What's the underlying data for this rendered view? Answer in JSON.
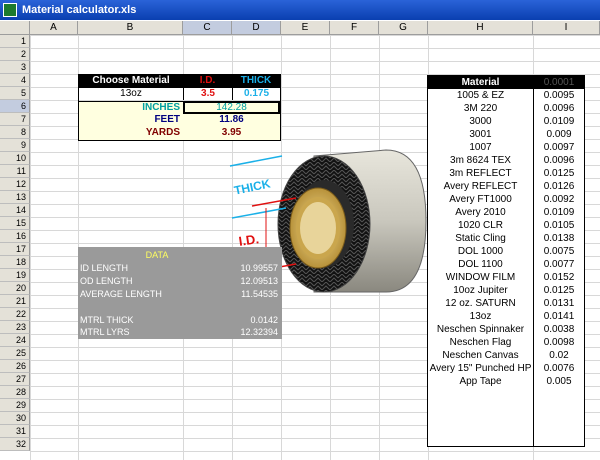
{
  "window": {
    "title": "Material calculator.xls"
  },
  "columns": [
    "A",
    "B",
    "C",
    "D",
    "E",
    "F",
    "G",
    "H",
    "I"
  ],
  "rows": [
    "1",
    "2",
    "3",
    "4",
    "5",
    "6",
    "7",
    "8",
    "9",
    "10",
    "11",
    "12",
    "13",
    "14",
    "15",
    "16",
    "17",
    "18",
    "19",
    "20",
    "21",
    "22",
    "23",
    "24",
    "25",
    "26",
    "27",
    "28",
    "29",
    "30",
    "31",
    "32"
  ],
  "calculator": {
    "choose_material_label": "Choose Material",
    "id_label": "I.D.",
    "thick_label": "THICK",
    "material_value": "13oz",
    "id_value": "3.5",
    "thick_value": "0.175",
    "inches_label": "INCHES",
    "inches_value": "142.28",
    "feet_label": "FEET",
    "feet_value": "11.86",
    "yards_label": "YARDS",
    "yards_value": "3.95"
  },
  "data_panel": {
    "title": "DATA",
    "id_length_label": "ID LENGTH",
    "id_length_value": "10.99557",
    "od_length_label": "OD LENGTH",
    "od_length_value": "12.09513",
    "avg_length_label": "AVERAGE LENGTH",
    "avg_length_value": "11.54535",
    "mtrl_thick_label": "MTRL THICK",
    "mtrl_thick_value": "0.0142",
    "mtrl_lyrs_label": "MTRL LYRS",
    "mtrl_lyrs_value": "12.32394"
  },
  "diagram": {
    "thick_label": "THICK",
    "id_label": "I.D."
  },
  "materials": {
    "header_name": "Material",
    "header_value": "0.0001",
    "items": [
      {
        "name": "1005 & EZ",
        "value": "0.0095"
      },
      {
        "name": "3M 220",
        "value": "0.0096"
      },
      {
        "name": "3000",
        "value": "0.0109"
      },
      {
        "name": "3001",
        "value": "0.009"
      },
      {
        "name": "1007",
        "value": "0.0097"
      },
      {
        "name": "3m 8624 TEX",
        "value": "0.0096"
      },
      {
        "name": "3m REFLECT",
        "value": "0.0125"
      },
      {
        "name": "Avery REFLECT",
        "value": "0.0126"
      },
      {
        "name": "Avery FT1000",
        "value": "0.0092"
      },
      {
        "name": "Avery 2010",
        "value": "0.0109"
      },
      {
        "name": "1020 CLR",
        "value": "0.0105"
      },
      {
        "name": "Static Cling",
        "value": "0.0138"
      },
      {
        "name": "DOL 1000",
        "value": "0.0075"
      },
      {
        "name": "DOL 1100",
        "value": "0.0077"
      },
      {
        "name": "WINDOW FILM",
        "value": "0.0152"
      },
      {
        "name": "10oz Jupiter",
        "value": "0.0125"
      },
      {
        "name": "12 oz. SATURN",
        "value": "0.0131"
      },
      {
        "name": "13oz",
        "value": "0.0141"
      },
      {
        "name": "Neschen Spinnaker",
        "value": "0.0038"
      },
      {
        "name": "Neschen Flag",
        "value": "0.0098"
      },
      {
        "name": "Neschen Canvas",
        "value": "0.02"
      },
      {
        "name": "Avery 15\" Punched HP",
        "value": "0.0076"
      },
      {
        "name": "App Tape",
        "value": "0.005"
      }
    ]
  },
  "colors": {
    "title_blue": "#0a3fb0",
    "id_red": "#e01010",
    "thick_cyan": "#1ab0e8",
    "teal": "#00a0a0",
    "navy": "#000080",
    "maroon": "#800000",
    "cream": "#ffffe0",
    "panel_gray": "#9a9a9a"
  }
}
